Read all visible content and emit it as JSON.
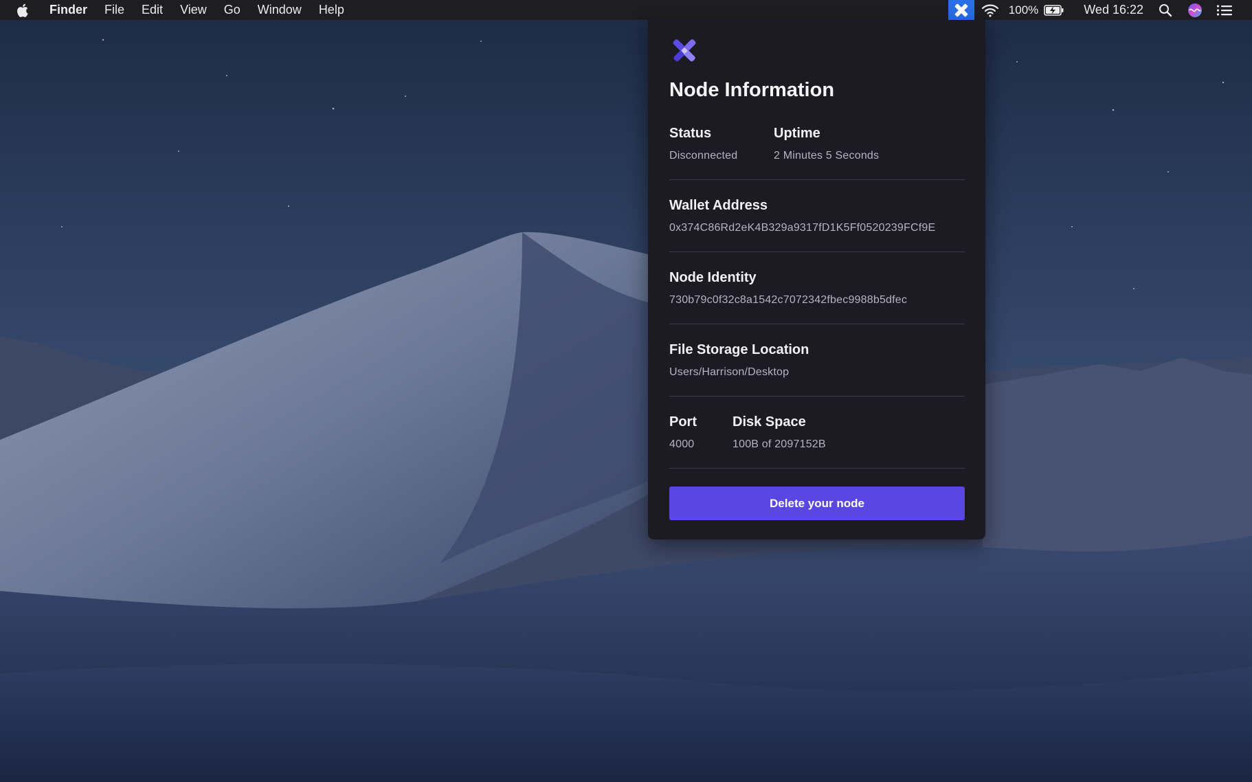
{
  "menubar": {
    "app_name": "Finder",
    "menus": [
      "File",
      "Edit",
      "View",
      "Go",
      "Window",
      "Help"
    ],
    "battery": "100%",
    "clock": "Wed 16:22",
    "icons": [
      "apple-icon",
      "node-app-icon",
      "wifi-icon",
      "battery-charging-icon",
      "spotlight-search-icon",
      "siri-icon",
      "notification-center-icon"
    ]
  },
  "panel": {
    "title": "Node Information",
    "status_label": "Status",
    "status_value": "Disconnected",
    "uptime_label": "Uptime",
    "uptime_value": "2 Minutes 5 Seconds",
    "wallet_label": "Wallet Address",
    "wallet_value": "0x374C86Rd2eK4B329a9317fD1K5Ff0520239FCf9E",
    "identity_label": "Node Identity",
    "identity_value": "730b79c0f32c8a1542c7072342fbec9988b5dfec",
    "storage_label": "File Storage Location",
    "storage_value": "Users/Harrison/Desktop",
    "port_label": "Port",
    "port_value": "4000",
    "disk_label": "Disk Space",
    "disk_value": "100B of 2097152B",
    "delete_button": "Delete your node"
  },
  "colors": {
    "accent": "#5a46e0",
    "status_app_highlight": "#2a6fe6",
    "panel_bg": "#1c1b24"
  }
}
